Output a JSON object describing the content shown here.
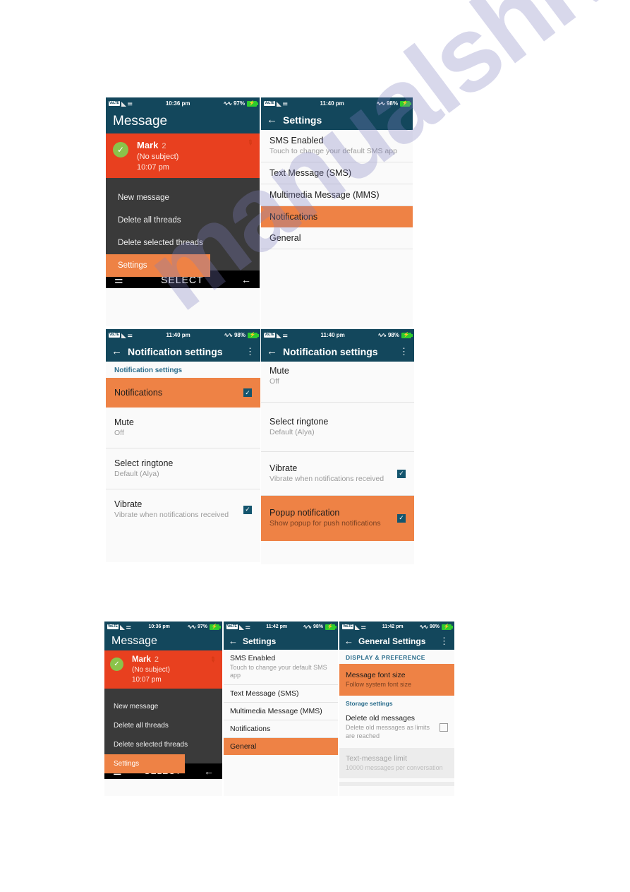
{
  "watermark": {
    "text": "manualshive.com"
  },
  "colors": {
    "appbar": "#13475c",
    "accent_orange": "#ee8245",
    "message_red": "#e8401f",
    "check_green": "#8bc34a",
    "checkbox_blue": "#14556e",
    "section_header": "#2a6d8c"
  },
  "panels": {
    "p1": {
      "status": {
        "carrier": "VoLTE",
        "network": "4G",
        "time": "10:36 pm",
        "battery": "97%",
        "usb_icon": "usb-icon",
        "signal_icon": "signal-icon",
        "wifi_icon": "wifi-icon",
        "battery_icon": "battery-charging-icon"
      },
      "appbar": {
        "title": "Message"
      },
      "message": {
        "name": "Mark",
        "count": "2",
        "subject": "(No subject)",
        "time": "10:07 pm",
        "check_icon": "check-circle-icon",
        "pin_icon": "pin-icon"
      },
      "menu": [
        {
          "label": "New message",
          "selected": false
        },
        {
          "label": "Delete all threads",
          "selected": false
        },
        {
          "label": "Delete selected threads",
          "selected": false
        },
        {
          "label": "Settings",
          "selected": true
        }
      ],
      "navbar": {
        "menu_icon": "hamburger-icon",
        "select_label": "SELECT",
        "back_icon": "back-arrow-icon"
      }
    },
    "p2": {
      "status": {
        "time": "11:40 pm",
        "battery": "98%"
      },
      "appbar": {
        "back_icon": "back-arrow-icon",
        "title": "Settings"
      },
      "items": [
        {
          "title": "SMS Enabled",
          "sub": "Touch to change your default SMS app",
          "selected": false
        },
        {
          "title": "Text Message (SMS)",
          "sub": "",
          "selected": false
        },
        {
          "title": "Multimedia Message (MMS)",
          "sub": "",
          "selected": false
        },
        {
          "title": "Notifications",
          "sub": "",
          "selected": true
        },
        {
          "title": "General",
          "sub": "",
          "selected": false
        }
      ]
    },
    "p3": {
      "status": {
        "time": "11:40 pm",
        "battery": "98%"
      },
      "appbar": {
        "back_icon": "back-arrow-icon",
        "title": "Notification settings",
        "kebab_icon": "more-vertical-icon"
      },
      "section": "Notification settings",
      "items": [
        {
          "title": "Notifications",
          "sub": "",
          "selected": true,
          "checkbox": "checked"
        },
        {
          "title": "Mute",
          "sub": "Off",
          "selected": false,
          "checkbox": "none"
        },
        {
          "title": "Select ringtone",
          "sub": "Default (Alya)",
          "selected": false,
          "checkbox": "none"
        },
        {
          "title": "Vibrate",
          "sub": "Vibrate when notifications received",
          "selected": false,
          "checkbox": "checked"
        }
      ]
    },
    "p4": {
      "status": {
        "time": "11:40 pm",
        "battery": "98%"
      },
      "appbar": {
        "back_icon": "back-arrow-icon",
        "title": "Notification settings",
        "kebab_icon": "more-vertical-icon"
      },
      "items": [
        {
          "title": "Mute",
          "sub": "Off",
          "selected": false,
          "checkbox": "none"
        },
        {
          "title": "Select ringtone",
          "sub": "Default (Alya)",
          "selected": false,
          "checkbox": "none"
        },
        {
          "title": "Vibrate",
          "sub": "Vibrate when notifications received",
          "selected": false,
          "checkbox": "checked"
        },
        {
          "title": "Popup notification",
          "sub": "Show popup for push notifications",
          "selected": true,
          "checkbox": "checked"
        }
      ]
    },
    "p5": {
      "status": {
        "time": "10:36 pm",
        "battery": "97%"
      },
      "appbar": {
        "title": "Message"
      },
      "message": {
        "name": "Mark",
        "count": "2",
        "subject": "(No subject)",
        "time": "10:07 pm"
      },
      "menu": [
        {
          "label": "New message",
          "selected": false
        },
        {
          "label": "Delete all threads",
          "selected": false
        },
        {
          "label": "Delete selected threads",
          "selected": false
        },
        {
          "label": "Settings",
          "selected": true
        }
      ],
      "navbar": {
        "select_label": "SELECT"
      }
    },
    "p6": {
      "status": {
        "time": "11:42 pm",
        "battery": "98%"
      },
      "appbar": {
        "back_icon": "back-arrow-icon",
        "title": "Settings"
      },
      "items": [
        {
          "title": "SMS Enabled",
          "sub": "Touch to change your default SMS app",
          "selected": false
        },
        {
          "title": "Text Message (SMS)",
          "sub": "",
          "selected": false
        },
        {
          "title": "Multimedia Message (MMS)",
          "sub": "",
          "selected": false
        },
        {
          "title": "Notifications",
          "sub": "",
          "selected": false
        },
        {
          "title": "General",
          "sub": "",
          "selected": true
        }
      ]
    },
    "p7": {
      "status": {
        "time": "11:42 pm",
        "battery": "98%"
      },
      "appbar": {
        "back_icon": "back-arrow-icon",
        "title": "General Settings",
        "kebab_icon": "more-vertical-icon"
      },
      "section1": "DISPLAY & PREFERENCE",
      "section2": "Storage settings",
      "items": [
        {
          "title": "Message font size",
          "sub": "Follow system font size",
          "selected": true,
          "checkbox": "none"
        },
        {
          "title": "Delete old messages",
          "sub": "Delete old messages as limits are reached",
          "selected": false,
          "checkbox": "unchecked"
        },
        {
          "title": "Text-message limit",
          "sub": "10000 messages per conversation",
          "selected": false,
          "checkbox": "none",
          "dim": true
        }
      ]
    }
  }
}
